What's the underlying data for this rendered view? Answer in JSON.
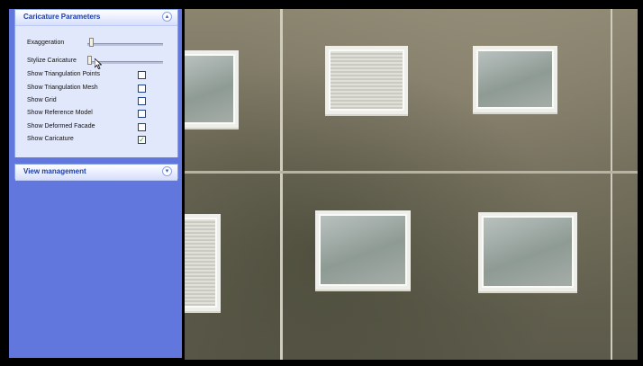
{
  "caricature_panel": {
    "title": "Caricature Parameters",
    "collapse_icon": "double-chevron-up-icon",
    "sliders": [
      {
        "label": "Exaggeration",
        "value": 0.02
      },
      {
        "label": "Stylize Caricature",
        "value": 0.0
      }
    ],
    "options": [
      {
        "label": "Show Triangulation Points",
        "checked": false
      },
      {
        "label": "Show Triangulation Mesh",
        "checked": false
      },
      {
        "label": "Show Grid",
        "checked": false
      },
      {
        "label": "Show Reference Model",
        "checked": false
      },
      {
        "label": "Show Deformed Facade",
        "checked": false
      },
      {
        "label": "Show Caricature",
        "checked": true
      }
    ]
  },
  "view_panel": {
    "title": "View management",
    "expand_icon": "double-chevron-down-icon"
  },
  "viewport": {
    "content": "building-facade-image"
  },
  "colors": {
    "sidebar": "#6277dd",
    "panel_title": "#1c3ea8",
    "checkmark": "#2a9a2a"
  }
}
